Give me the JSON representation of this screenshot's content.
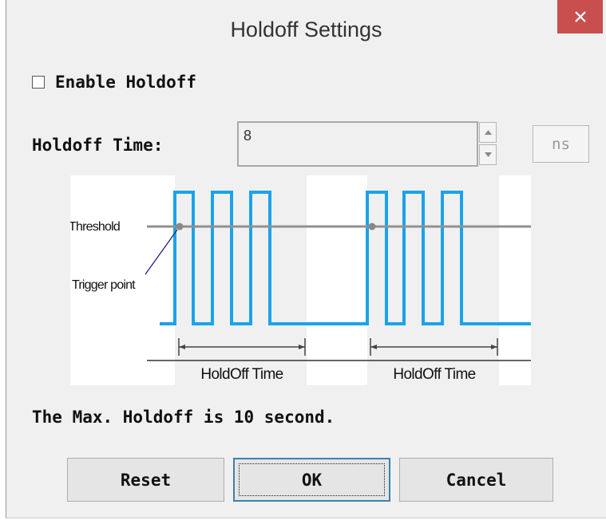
{
  "window": {
    "title": "Holdoff Settings",
    "close_glyph": "×"
  },
  "enable_holdoff": {
    "label": "Enable Holdoff",
    "checked": false
  },
  "holdoff_time": {
    "label": "Holdoff Time:",
    "value": "8",
    "unit_button": "ns"
  },
  "diagram": {
    "threshold_label": "Threshold",
    "trigger_label": "Trigger point",
    "holdoff_label_1": "HoldOff Time",
    "holdoff_label_2": "HoldOff Time",
    "signal_color": "#1aa3e8"
  },
  "max_note": "The Max. Holdoff is 10 second.",
  "buttons": {
    "reset": "Reset",
    "ok": "OK",
    "cancel": "Cancel"
  }
}
